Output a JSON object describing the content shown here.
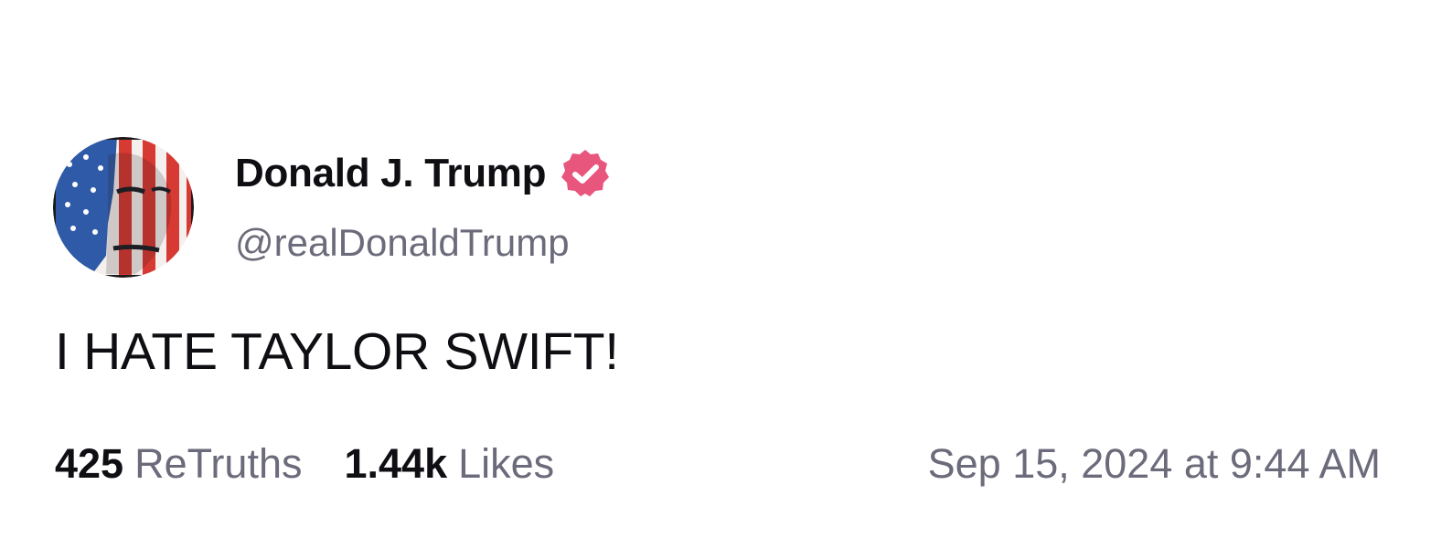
{
  "post": {
    "author": {
      "display_name": "Donald J. Trump",
      "handle": "@realDonaldTrump",
      "verified": true,
      "verified_icon": "verified-badge-icon",
      "verified_color": "#e8567d"
    },
    "text": "I HATE TAYLOR SWIFT!",
    "stats": {
      "retruths_count": "425",
      "retruths_label": "ReTruths",
      "likes_count": "1.44k",
      "likes_label": "Likes"
    },
    "timestamp": "Sep 15, 2024 at 9:44 AM"
  },
  "colors": {
    "primary_text": "#0e0e13",
    "secondary_text": "#6b6b7b",
    "background": "#ffffff"
  }
}
